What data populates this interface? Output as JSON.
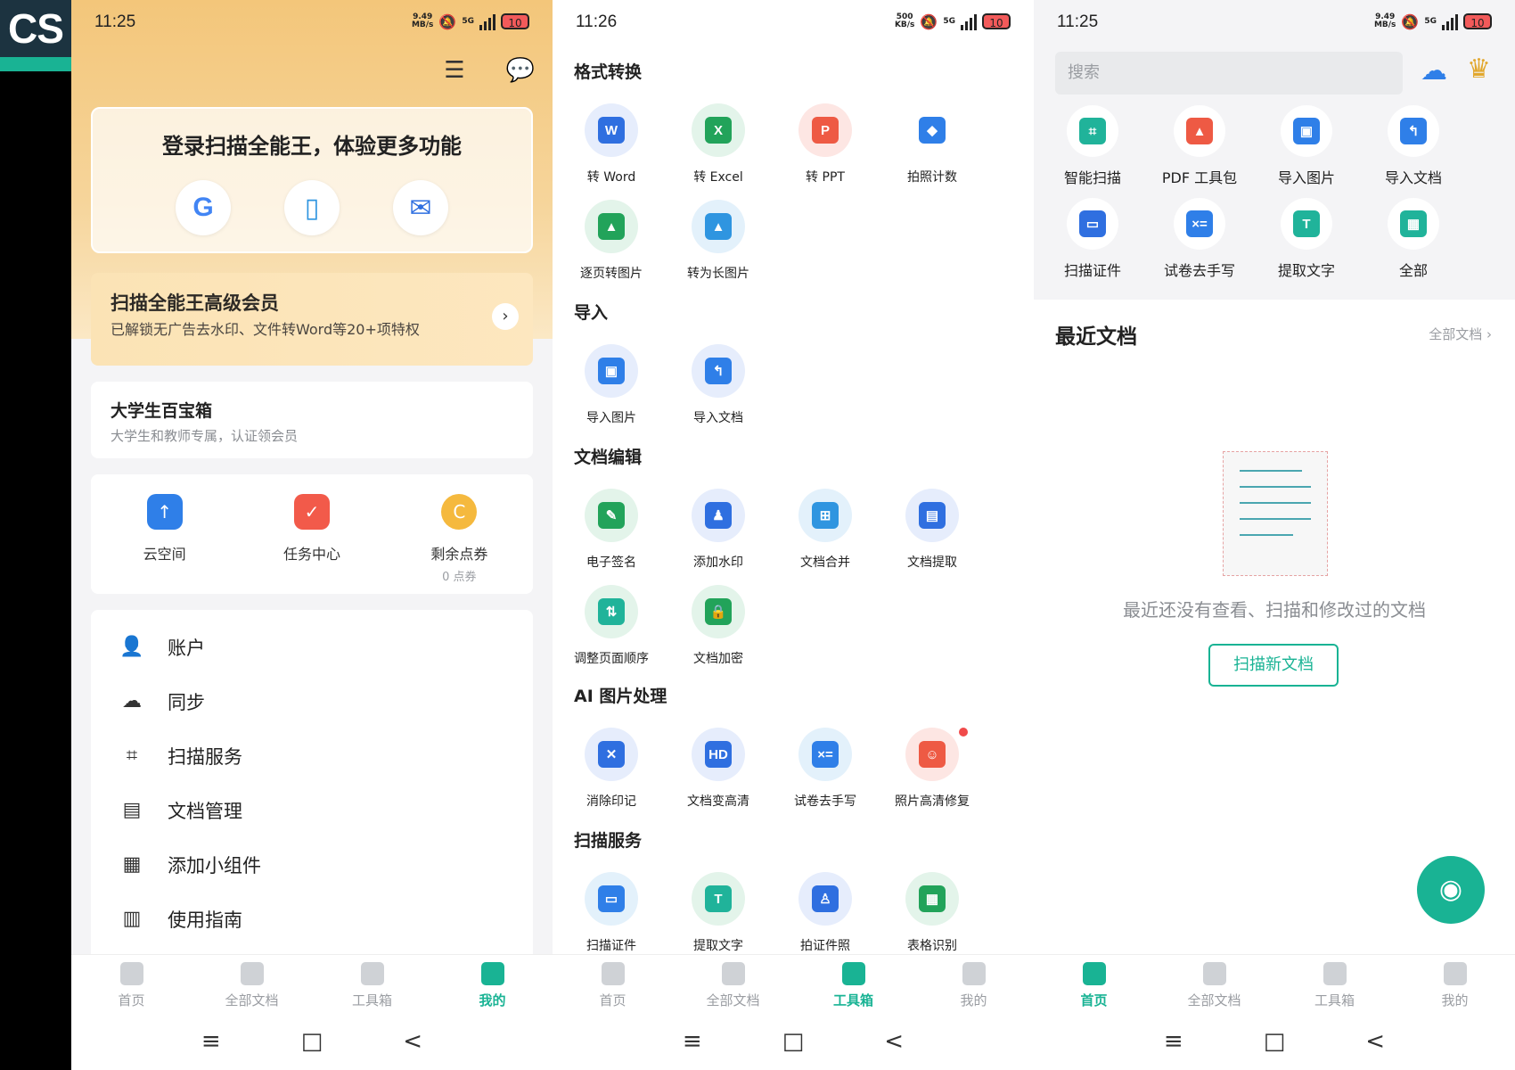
{
  "logo": {
    "text": "CS"
  },
  "panel1": {
    "status": {
      "time": "11:25",
      "speed_top": "9.49",
      "speed_bottom": "MB/s",
      "net": "5G",
      "battery": "10"
    },
    "header_icons": [
      "scan-frame-icon",
      "message-icon"
    ],
    "login": {
      "title": "登录扫描全能王，体验更多功能",
      "methods": [
        "google-icon",
        "phone-icon",
        "email-icon"
      ],
      "google_glyph": "G",
      "phone_glyph": "▯",
      "email_glyph": "✉"
    },
    "vip": {
      "title": "扫描全能王高级会员",
      "subtitle": "已解锁无广告去水印、文件转Word等20+项特权",
      "arrow": "›"
    },
    "student": {
      "title": "大学生百宝箱",
      "subtitle": "大学生和教师专属，认证领会员"
    },
    "quick": [
      {
        "label": "云空间",
        "sub": "",
        "glyph": "↑",
        "color": "#2f7fe8"
      },
      {
        "label": "任务中心",
        "sub": "",
        "glyph": "✓",
        "color": "#f25a4a"
      },
      {
        "label": "剩余点券",
        "sub": "0 点券",
        "glyph": "C",
        "color": "#f5b93e"
      }
    ],
    "menu": [
      {
        "label": "账户",
        "glyph": "👤"
      },
      {
        "label": "同步",
        "glyph": "☁"
      },
      {
        "label": "扫描服务",
        "glyph": "⌗"
      },
      {
        "label": "文档管理",
        "glyph": "▤"
      },
      {
        "label": "添加小组件",
        "glyph": "▦"
      },
      {
        "label": "使用指南",
        "glyph": "▥"
      }
    ],
    "tabs": [
      {
        "label": "首页",
        "active": false
      },
      {
        "label": "全部文档",
        "active": false
      },
      {
        "label": "工具箱",
        "active": false
      },
      {
        "label": "我的",
        "active": true
      }
    ],
    "nav": [
      "≡",
      "□",
      "<"
    ]
  },
  "panel2": {
    "status": {
      "time": "11:26",
      "speed_top": "500",
      "speed_bottom": "KB/s",
      "net": "5G",
      "battery": "10"
    },
    "sections": [
      {
        "title": "格式转换",
        "items": [
          {
            "label": "转 Word",
            "glyph": "W",
            "bubble": "#e6edfc",
            "color": "#2f6fe0"
          },
          {
            "label": "转 Excel",
            "glyph": "X",
            "bubble": "#e3f4ea",
            "color": "#22a35a"
          },
          {
            "label": "转 PPT",
            "glyph": "P",
            "bubble": "#fde6e3",
            "color": "#ee5a44"
          },
          {
            "label": "拍照计数",
            "glyph": "◆",
            "bubble": "#ffffff",
            "color": "#2f7fe8"
          },
          {
            "label": "逐页转图片",
            "glyph": "▲",
            "bubble": "#e3f4ea",
            "color": "#22a35a"
          },
          {
            "label": "转为长图片",
            "glyph": "▲",
            "bubble": "#e3f1fb",
            "color": "#2f95e0"
          }
        ]
      },
      {
        "title": "导入",
        "items": [
          {
            "label": "导入图片",
            "glyph": "▣",
            "bubble": "#e6edfc",
            "color": "#2f7fe8"
          },
          {
            "label": "导入文档",
            "glyph": "↰",
            "bubble": "#e6edfc",
            "color": "#2f7fe8"
          }
        ]
      },
      {
        "title": "文档编辑",
        "items": [
          {
            "label": "电子签名",
            "glyph": "✎",
            "bubble": "#e3f4ea",
            "color": "#22a35a"
          },
          {
            "label": "添加水印",
            "glyph": "♟",
            "bubble": "#e6edfc",
            "color": "#2f6fe0"
          },
          {
            "label": "文档合并",
            "glyph": "⊞",
            "bubble": "#e3f1fb",
            "color": "#2f95e0"
          },
          {
            "label": "文档提取",
            "glyph": "▤",
            "bubble": "#e6edfc",
            "color": "#2f6fe0"
          },
          {
            "label": "调整页面顺序",
            "glyph": "⇅",
            "bubble": "#e3f4ea",
            "color": "#20b39a"
          },
          {
            "label": "文档加密",
            "glyph": "🔒",
            "bubble": "#e3f4ea",
            "color": "#22a35a"
          }
        ]
      },
      {
        "title": "AI 图片处理",
        "items": [
          {
            "label": "消除印记",
            "glyph": "✕",
            "bubble": "#e6edfc",
            "color": "#2f6fe0"
          },
          {
            "label": "文档变高清",
            "glyph": "HD",
            "bubble": "#e6edfc",
            "color": "#2f6fe0"
          },
          {
            "label": "试卷去手写",
            "glyph": "×=",
            "bubble": "#e3f1fb",
            "color": "#2f7fe8"
          },
          {
            "label": "照片高清修复",
            "glyph": "☺",
            "bubble": "#fde6e3",
            "color": "#ee5a44"
          }
        ]
      },
      {
        "title": "扫描服务",
        "items": [
          {
            "label": "扫描证件",
            "glyph": "▭",
            "bubble": "#e3f1fb",
            "color": "#2f7fe8"
          },
          {
            "label": "提取文字",
            "glyph": "T",
            "bubble": "#e3f4ea",
            "color": "#20b39a"
          },
          {
            "label": "拍证件照",
            "glyph": "♙",
            "bubble": "#e6edfc",
            "color": "#2f6fe0"
          },
          {
            "label": "表格识别",
            "glyph": "▦",
            "bubble": "#e3f4ea",
            "color": "#22a35a"
          }
        ]
      }
    ],
    "tabs": [
      {
        "label": "首页",
        "active": false
      },
      {
        "label": "全部文档",
        "active": false
      },
      {
        "label": "工具箱",
        "active": true
      },
      {
        "label": "我的",
        "active": false
      }
    ],
    "nav": [
      "≡",
      "□",
      "<"
    ]
  },
  "panel3": {
    "status": {
      "time": "11:25",
      "speed_top": "9.49",
      "speed_bottom": "MB/s",
      "net": "5G",
      "battery": "10"
    },
    "search_placeholder": "搜索",
    "cloud_glyph": "☁",
    "crown_glyph": "♛",
    "tools": [
      {
        "label": "智能扫描",
        "glyph": "⌗",
        "color": "#20b39a"
      },
      {
        "label": "PDF 工具包",
        "glyph": "▲",
        "color": "#ee5a44"
      },
      {
        "label": "导入图片",
        "glyph": "▣",
        "color": "#2f7fe8"
      },
      {
        "label": "导入文档",
        "glyph": "↰",
        "color": "#2f7fe8"
      },
      {
        "label": "扫描证件",
        "glyph": "▭",
        "color": "#2f6fe0"
      },
      {
        "label": "试卷去手写",
        "glyph": "×=",
        "color": "#2f7fe8"
      },
      {
        "label": "提取文字",
        "glyph": "T",
        "color": "#20b39a"
      },
      {
        "label": "全部",
        "glyph": "▦",
        "color": "#20b39a"
      }
    ],
    "recent_title": "最近文档",
    "recent_all": "全部文档 ›",
    "empty_text": "最近还没有查看、扫描和修改过的文档",
    "scan_button": "扫描新文档",
    "fab_glyph": "◉",
    "tabs": [
      {
        "label": "首页",
        "active": true
      },
      {
        "label": "全部文档",
        "active": false
      },
      {
        "label": "工具箱",
        "active": false
      },
      {
        "label": "我的",
        "active": false
      }
    ],
    "nav": [
      "≡",
      "□",
      "<"
    ]
  }
}
